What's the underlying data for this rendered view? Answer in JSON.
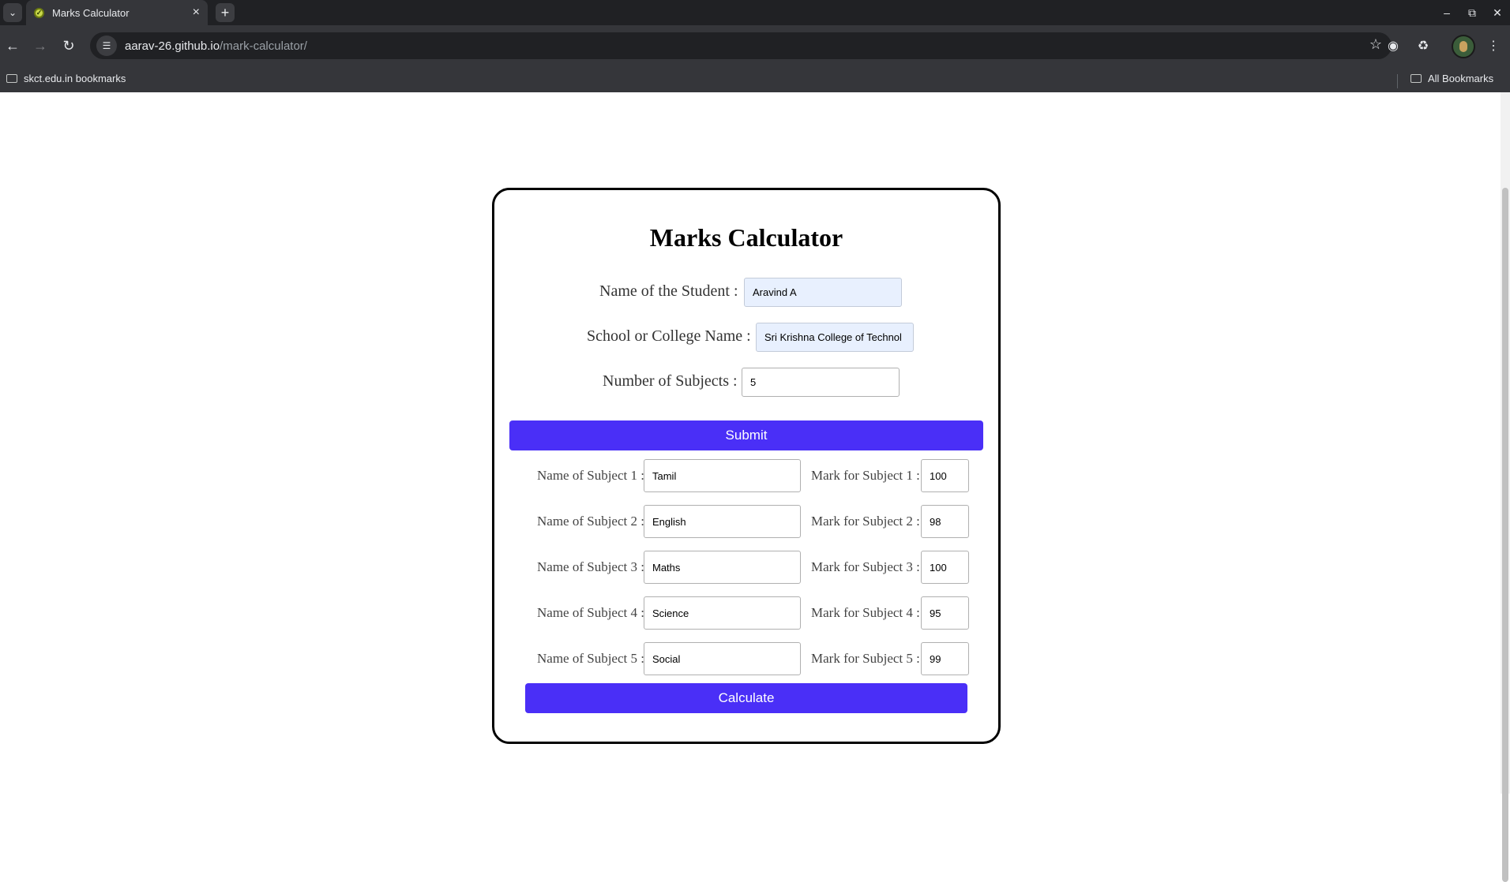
{
  "browser": {
    "tab_title": "Marks Calculator",
    "url_host": "aarav-26.github.io",
    "url_path": "/mark-calculator/",
    "bookmarks_left": "skct.edu.in bookmarks",
    "bookmarks_right": "All Bookmarks"
  },
  "form": {
    "title": "Marks Calculator",
    "student_label": "Name of the Student :",
    "student_value": "Aravind A",
    "college_label": "School or College Name :",
    "college_value": "Sri Krishna College of Technol",
    "subjects_count_label": "Number of Subjects :",
    "subjects_count_value": "5",
    "submit_label": "Submit",
    "calculate_label": "Calculate",
    "subjects": [
      {
        "name_label": "Name of Subject 1 :",
        "name_value": "Tamil",
        "mark_label": "Mark for Subject 1 :",
        "mark_value": "100"
      },
      {
        "name_label": "Name of Subject 2 :",
        "name_value": "English",
        "mark_label": "Mark for Subject 2 :",
        "mark_value": "98"
      },
      {
        "name_label": "Name of Subject 3 :",
        "name_value": "Maths",
        "mark_label": "Mark for Subject 3 :",
        "mark_value": "100"
      },
      {
        "name_label": "Name of Subject 4 :",
        "name_value": "Science",
        "mark_label": "Mark for Subject 4 :",
        "mark_value": "95"
      },
      {
        "name_label": "Name of Subject 5 :",
        "name_value": "Social",
        "mark_label": "Mark for Subject 5 :",
        "mark_value": "99"
      }
    ]
  },
  "colors": {
    "button_bg": "#4a2ff7",
    "autofill_bg": "#e8f0fe"
  }
}
